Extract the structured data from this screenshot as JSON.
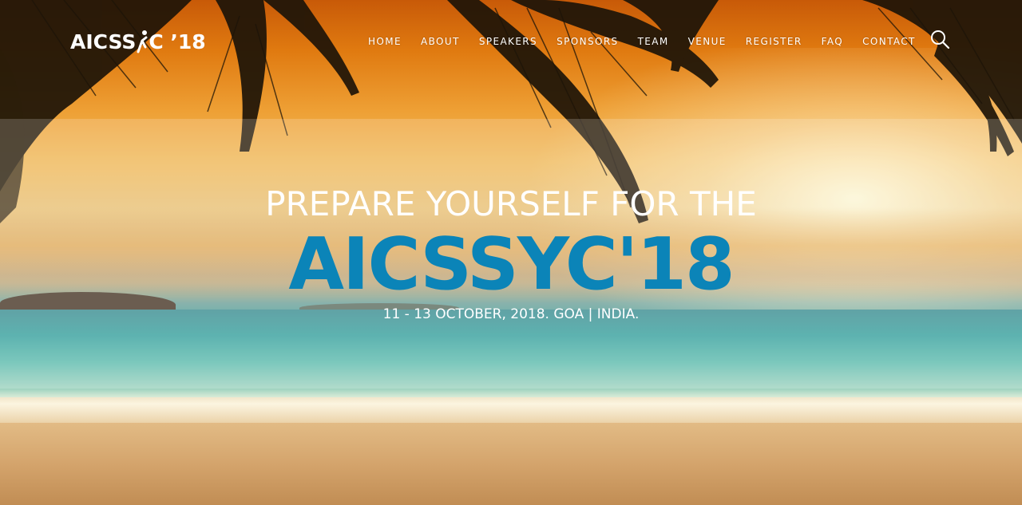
{
  "header": {
    "logo_text_left": "AICSS",
    "logo_text_right": "C ’18",
    "nav": [
      {
        "label": "HOME"
      },
      {
        "label": "ABOUT"
      },
      {
        "label": "SPEAKERS"
      },
      {
        "label": "SPONSORS"
      },
      {
        "label": "TEAM"
      },
      {
        "label": "VENUE"
      },
      {
        "label": "REGISTER"
      },
      {
        "label": "FAQ"
      },
      {
        "label": "CONTACT"
      }
    ],
    "search_icon": "search-icon"
  },
  "hero": {
    "kicker": "PREPARE YOURSELF FOR THE",
    "title": "AICSSYC'18",
    "date": "11 - 13 OCTOBER, 2018. GOA | INDIA."
  },
  "colors": {
    "title_accent": "#0b84b8",
    "nav_text": "#ffffff"
  }
}
